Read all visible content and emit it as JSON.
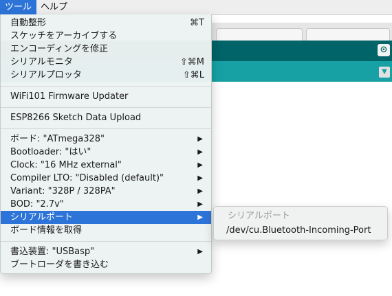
{
  "menubar": {
    "tools": "ツール",
    "help": "ヘルプ"
  },
  "menu": {
    "auto_format": {
      "label": "自動整形",
      "shortcut": "⌘T"
    },
    "archive_sketch": {
      "label": "スケッチをアーカイブする"
    },
    "fix_encoding": {
      "label": "エンコーディングを修正"
    },
    "serial_monitor": {
      "label": "シリアルモニタ",
      "shortcut": "⇧⌘M"
    },
    "serial_plotter": {
      "label": "シリアルプロッタ",
      "shortcut": "⇧⌘L"
    },
    "wifi101": {
      "label": "WiFi101 Firmware Updater"
    },
    "esp8266": {
      "label": "ESP8266 Sketch Data Upload"
    },
    "board": {
      "label": "ボード: \"ATmega328\""
    },
    "bootloader": {
      "label": "Bootloader: \"はい\""
    },
    "clock": {
      "label": "Clock: \"16 MHz external\""
    },
    "compiler_lto": {
      "label": "Compiler LTO: \"Disabled (default)\""
    },
    "variant": {
      "label": "Variant: \"328P / 328PA\""
    },
    "bod": {
      "label": "BOD: \"2.7v\""
    },
    "serial_port": {
      "label": "シリアルポート"
    },
    "board_info": {
      "label": "ボード情報を取得"
    },
    "programmer": {
      "label": "書込装置: \"USBasp\""
    },
    "burn_bootloader": {
      "label": "ブートローダを書き込む"
    },
    "submenu_arrow": "▶"
  },
  "submenu": {
    "header": "シリアルポート",
    "items": [
      "/dev/cu.Bluetooth-Incoming-Port"
    ]
  },
  "icons": {
    "serial_monitor_button": "⊙",
    "tab_dropdown": "▼"
  },
  "colors": {
    "highlight": "#2d74d8",
    "toolbar_dark": "#006468",
    "toolbar_teal": "#17a1a5"
  }
}
